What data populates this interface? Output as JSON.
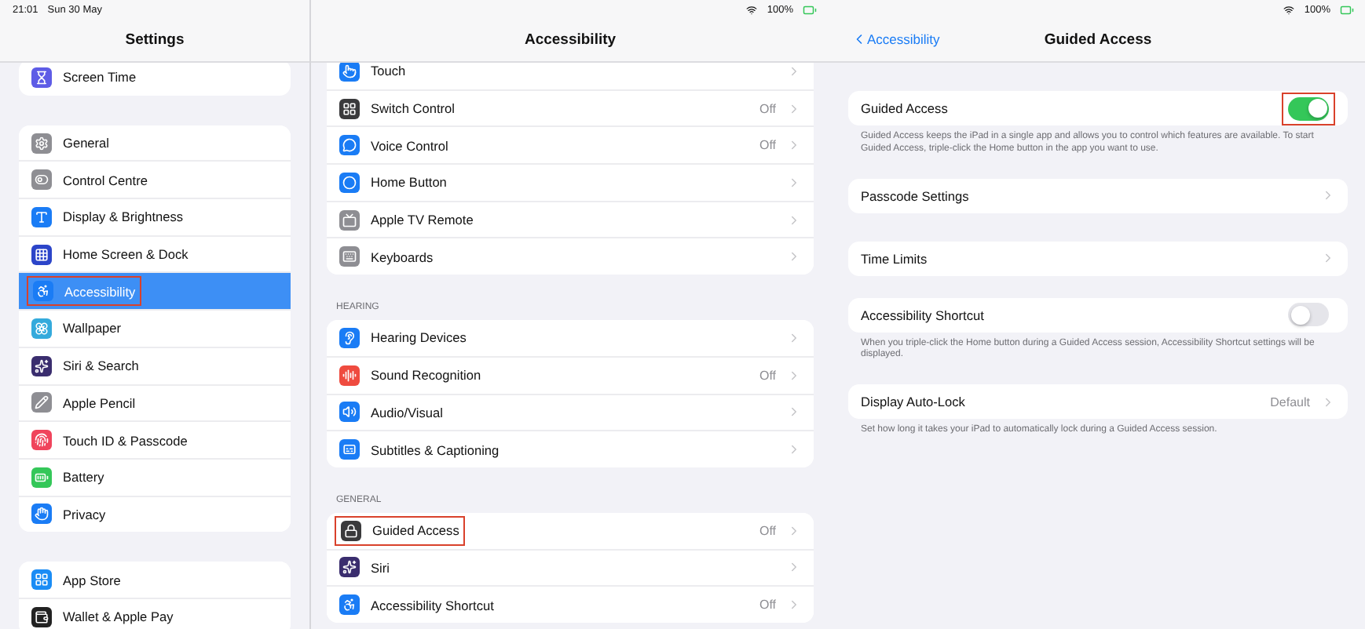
{
  "left_screen": {
    "status_bar": {
      "time": "21:01",
      "date": "Sun 30 May",
      "battery": "100%"
    },
    "settings": {
      "title": "Settings",
      "groups": [
        {
          "items": [
            {
              "label": "Screen Time",
              "color": "#5e5ce6",
              "selected": false,
              "highlighted": false
            }
          ]
        },
        {
          "items": [
            {
              "label": "General",
              "color": "#8e8e93",
              "selected": false,
              "highlighted": false
            },
            {
              "label": "Control Centre",
              "color": "#8e8e93",
              "selected": false,
              "highlighted": false
            },
            {
              "label": "Display & Brightness",
              "color": "#1a7cf5",
              "selected": false,
              "highlighted": false
            },
            {
              "label": "Home Screen & Dock",
              "color": "#2c45c9",
              "selected": false,
              "highlighted": false
            },
            {
              "label": "Accessibility",
              "color": "#1a7cf5",
              "selected": true,
              "highlighted": true
            },
            {
              "label": "Wallpaper",
              "color": "#34aadc",
              "selected": false,
              "highlighted": false
            },
            {
              "label": "Siri & Search",
              "color": "#3a2d6e",
              "selected": false,
              "highlighted": false
            },
            {
              "label": "Apple Pencil",
              "color": "#8e8e93",
              "selected": false,
              "highlighted": false
            },
            {
              "label": "Touch ID & Passcode",
              "color": "#f0445c",
              "selected": false,
              "highlighted": false
            },
            {
              "label": "Battery",
              "color": "#34c759",
              "selected": false,
              "highlighted": false
            },
            {
              "label": "Privacy",
              "color": "#1a7cf5",
              "selected": false,
              "highlighted": false
            }
          ]
        },
        {
          "items": [
            {
              "label": "App Store",
              "color": "#1a8cf5",
              "selected": false,
              "highlighted": false
            },
            {
              "label": "Wallet & Apple Pay",
              "color": "#222222",
              "selected": false,
              "highlighted": false
            }
          ]
        }
      ]
    },
    "accessibility": {
      "title": "Accessibility",
      "groups": [
        {
          "items": [
            {
              "label": "Touch",
              "color": "#1a7cf5",
              "highlighted": false
            },
            {
              "label": "Switch Control",
              "value": "Off",
              "color": "#3a3a3c",
              "highlighted": false
            },
            {
              "label": "Voice Control",
              "value": "Off",
              "color": "#1a7cf5",
              "highlighted": false
            },
            {
              "label": "Home Button",
              "color": "#1a7cf5",
              "highlighted": false
            },
            {
              "label": "Apple TV Remote",
              "color": "#8e8e93",
              "highlighted": false
            },
            {
              "label": "Keyboards",
              "color": "#8e8e93",
              "highlighted": false
            }
          ]
        },
        {
          "header": "HEARING",
          "items": [
            {
              "label": "Hearing Devices",
              "color": "#1a7cf5",
              "highlighted": false
            },
            {
              "label": "Sound Recognition",
              "value": "Off",
              "color": "#ef4b3f",
              "highlighted": false
            },
            {
              "label": "Audio/Visual",
              "color": "#1a7cf5",
              "highlighted": false
            },
            {
              "label": "Subtitles & Captioning",
              "color": "#1a7cf5",
              "highlighted": false
            }
          ]
        },
        {
          "header": "GENERAL",
          "items": [
            {
              "label": "Guided Access",
              "value": "Off",
              "color": "#3a3a3c",
              "highlighted": true
            },
            {
              "label": "Siri",
              "color": "#3a2d6e",
              "highlighted": false
            },
            {
              "label": "Accessibility Shortcut",
              "value": "Off",
              "color": "#1a7cf5",
              "highlighted": false
            }
          ]
        }
      ]
    }
  },
  "right_screen": {
    "status_bar": {
      "battery": "100%"
    },
    "back_link": "Accessibility",
    "title": "Guided Access",
    "groups": [
      {
        "items": [
          {
            "kind": "toggle",
            "label": "Guided Access",
            "on": true,
            "highlighted": true
          }
        ],
        "footer": "Guided Access keeps the iPad in a single app and allows you to control which features are available. To start Guided Access, triple-click the Home button in the app you want to use."
      },
      {
        "items": [
          {
            "kind": "link",
            "label": "Passcode Settings",
            "highlighted": false
          }
        ]
      },
      {
        "items": [
          {
            "kind": "link",
            "label": "Time Limits",
            "highlighted": false
          }
        ]
      },
      {
        "items": [
          {
            "kind": "toggle",
            "label": "Accessibility Shortcut",
            "on": false,
            "highlighted": false
          }
        ],
        "footer": "When you triple-click the Home button during a Guided Access session, Accessibility Shortcut settings will be displayed."
      },
      {
        "items": [
          {
            "kind": "link",
            "label": "Display Auto-Lock",
            "value": "Default",
            "highlighted": false
          }
        ],
        "footer": "Set how long it takes your iPad to automatically lock during a Guided Access session."
      }
    ]
  }
}
